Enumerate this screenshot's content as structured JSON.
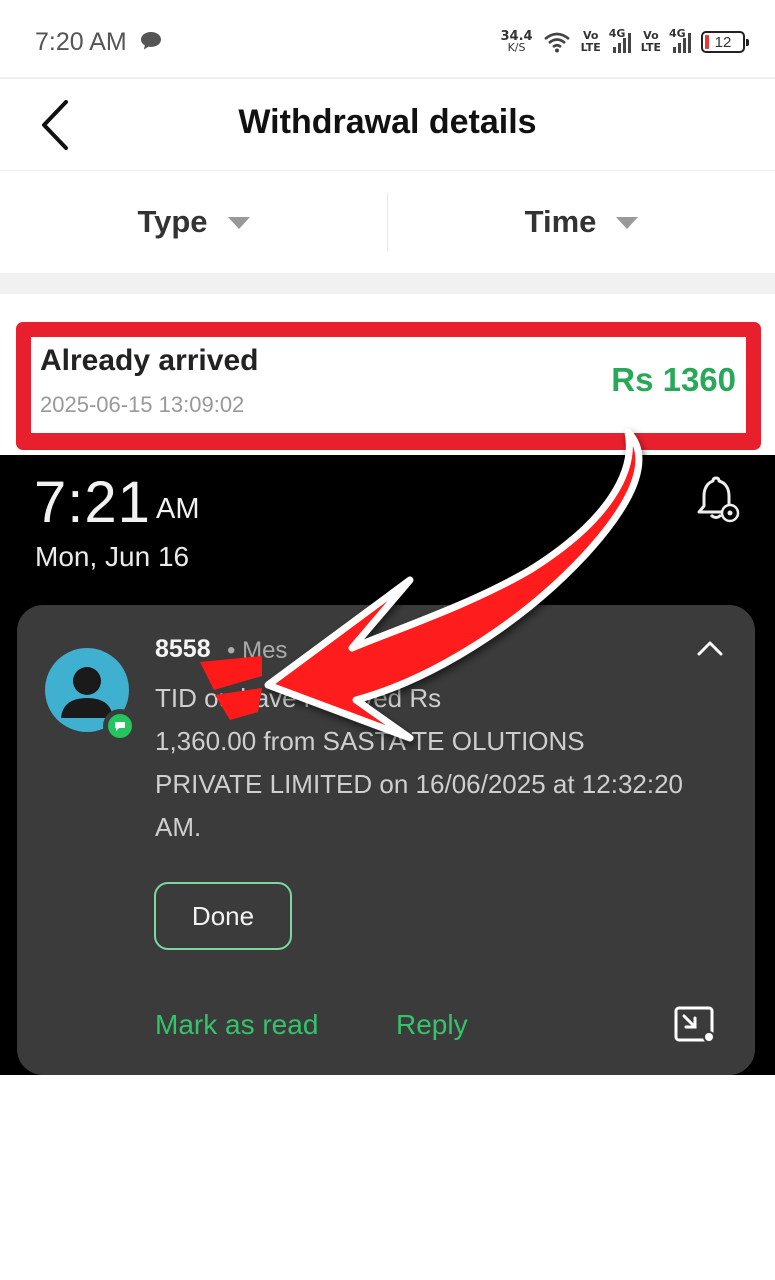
{
  "status_bar": {
    "time": "7:20 AM",
    "net_speed_value": "34.4",
    "net_speed_unit": "K/S",
    "sim1_volte_top": "Vo",
    "sim1_volte_bottom": "LTE",
    "sim1_network": "4G",
    "sim2_volte_top": "Vo",
    "sim2_volte_bottom": "LTE",
    "sim2_network": "4G",
    "battery_level": "12"
  },
  "header": {
    "title": "Withdrawal details"
  },
  "filters": {
    "type_label": "Type",
    "time_label": "Time"
  },
  "record": {
    "status": "Already arrived",
    "datetime": "2025-06-15 13:09:02",
    "amount": "Rs 1360",
    "amount_color": "#2aa85a",
    "highlight_color": "#e8202d"
  },
  "lockscreen": {
    "time": "7:21",
    "ampm": "AM",
    "date": "Mon, Jun 16",
    "notification": {
      "sender": "8558",
      "app": "• Mes",
      "body_line1": "TID                     ou have received Rs",
      "body_line2": "1,360.00 from SASTA TE      OLUTIONS",
      "body_line3": "PRIVATE LIMITED on 16/06/2025 at 12:32:20",
      "body_line4": "AM.",
      "done_label": "Done",
      "mark_read_label": "Mark as read",
      "reply_label": "Reply",
      "accent_color": "#33c46a"
    }
  }
}
